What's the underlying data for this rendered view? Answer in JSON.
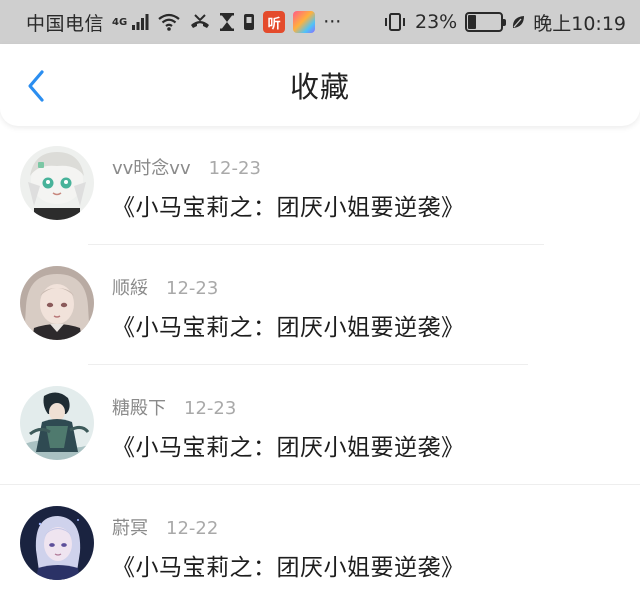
{
  "status_bar": {
    "carrier": "中国电信",
    "network_type": "4G",
    "app_badge_1": "听",
    "more": "···",
    "battery_percent": "23%",
    "battery_level": 0.23,
    "time": "晚上10:19",
    "icons": [
      "signal-icon",
      "wifi-icon",
      "missed-call-icon",
      "hourglass-icon",
      "sim-icon",
      "app-badge-red",
      "app-badge-multicolor",
      "vibrate-icon",
      "battery-icon",
      "leaf-icon"
    ]
  },
  "nav": {
    "title": "收藏",
    "back_icon": "chevron-left-icon",
    "accent_color": "#2b8ef0"
  },
  "favorites": [
    {
      "user": "vv时念vv",
      "date": "12-23",
      "title": "《小马宝莉之：团厌小姐要逆袭》"
    },
    {
      "user": "顺綏",
      "date": "12-23",
      "title": "《小马宝莉之：团厌小姐要逆袭》"
    },
    {
      "user": "糖殿下",
      "date": "12-23",
      "title": "《小马宝莉之：团厌小姐要逆袭》"
    },
    {
      "user": "蔚冥",
      "date": "12-22",
      "title": "《小马宝莉之：团厌小姐要逆袭》"
    }
  ]
}
